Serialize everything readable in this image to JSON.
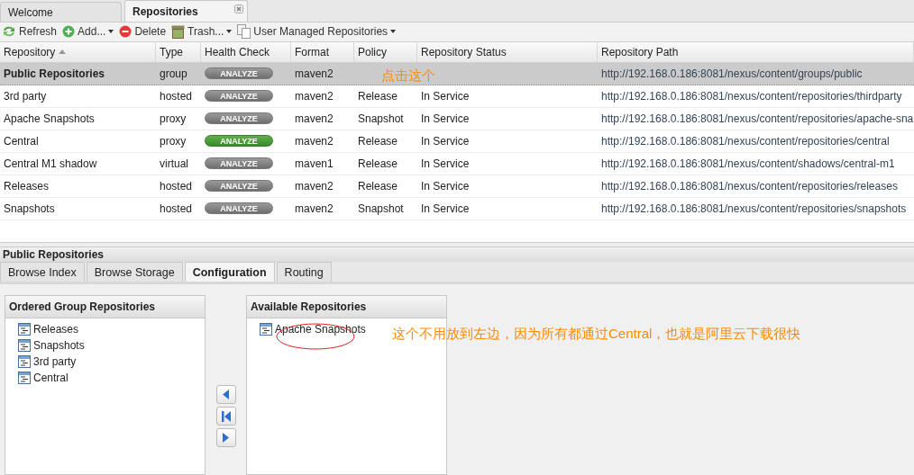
{
  "tabs": [
    {
      "label": "Welcome",
      "selected": false,
      "closable": false
    },
    {
      "label": "Repositories",
      "selected": true,
      "closable": true
    }
  ],
  "toolbar": [
    {
      "kind": "refresh",
      "label": "Refresh",
      "menu": false
    },
    {
      "kind": "add",
      "label": "Add...",
      "menu": true
    },
    {
      "kind": "delete",
      "label": "Delete",
      "menu": false
    },
    {
      "kind": "trash",
      "label": "Trash...",
      "menu": true
    },
    {
      "kind": "copy",
      "label": "User Managed Repositories",
      "menu": true
    }
  ],
  "table": {
    "columns": [
      {
        "label": "Repository",
        "sorted": true
      },
      {
        "label": "Type",
        "sorted": false
      },
      {
        "label": "Health Check",
        "sorted": false
      },
      {
        "label": "Format",
        "sorted": false
      },
      {
        "label": "Policy",
        "sorted": false
      },
      {
        "label": "Repository Status",
        "sorted": false
      },
      {
        "label": "Repository Path",
        "sorted": false
      }
    ],
    "rows": [
      {
        "name": "Public Repositories",
        "type": "group",
        "health": {
          "label": "ANALYZE",
          "active": false
        },
        "format": "maven2",
        "path": "http://192.168.0.186:8081/nexus/content/groups/public",
        "selected": true
      },
      {
        "name": "3rd party",
        "type": "hosted",
        "health": {
          "label": "ANALYZE",
          "active": false
        },
        "format": "maven2",
        "policy": "Release",
        "status": "In Service",
        "path": "http://192.168.0.186:8081/nexus/content/repositories/thirdparty",
        "selected": false
      },
      {
        "name": "Apache Snapshots",
        "type": "proxy",
        "health": {
          "label": "ANALYZE",
          "active": false
        },
        "format": "maven2",
        "policy": "Snapshot",
        "status": "In Service",
        "path": "http://192.168.0.186:8081/nexus/content/repositories/apache-sna",
        "selected": false
      },
      {
        "name": "Central",
        "type": "proxy",
        "health": {
          "label": "ANALYZE",
          "active": true
        },
        "format": "maven2",
        "policy": "Release",
        "status": "In Service",
        "path": "http://192.168.0.186:8081/nexus/content/repositories/central",
        "selected": false
      },
      {
        "name": "Central M1 shadow",
        "type": "virtual",
        "health": {
          "label": "ANALYZE",
          "active": false
        },
        "format": "maven1",
        "policy": "Release",
        "status": "In Service",
        "path": "http://192.168.0.186:8081/nexus/content/shadows/central-m1",
        "selected": false
      },
      {
        "name": "Releases",
        "type": "hosted",
        "health": {
          "label": "ANALYZE",
          "active": false
        },
        "format": "maven2",
        "policy": "Release",
        "status": "In Service",
        "path": "http://192.168.0.186:8081/nexus/content/repositories/releases",
        "selected": false
      },
      {
        "name": "Snapshots",
        "type": "hosted",
        "health": {
          "label": "ANALYZE",
          "active": false
        },
        "format": "maven2",
        "policy": "Snapshot",
        "status": "In Service",
        "path": "http://192.168.0.186:8081/nexus/content/repositories/snapshots",
        "selected": false
      }
    ]
  },
  "detail": {
    "title": "Public Repositories",
    "tabs": [
      {
        "label": "Browse Index",
        "selected": false
      },
      {
        "label": "Browse Storage",
        "selected": false
      },
      {
        "label": "Configuration",
        "selected": true
      },
      {
        "label": "Routing",
        "selected": false
      }
    ],
    "ordered": {
      "title": "Ordered Group Repositories",
      "items": [
        "Releases",
        "Snapshots",
        "3rd party",
        "Central"
      ]
    },
    "available": {
      "title": "Available Repositories",
      "items": [
        {
          "label": "Apache Snapshots",
          "circled": true
        }
      ]
    },
    "move_buttons": [
      {
        "kind": "left"
      },
      {
        "kind": "first"
      },
      {
        "kind": "right"
      }
    ]
  },
  "annotations": [
    {
      "kind": "row-note",
      "text": "点击这个"
    },
    {
      "kind": "list-note",
      "text": "这个不用放到左边，因为所有都通过Central，也就是阿里云下载很快"
    }
  ]
}
